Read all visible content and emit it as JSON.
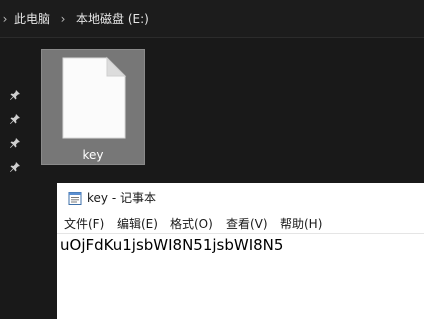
{
  "explorer": {
    "breadcrumb": [
      {
        "label": "此电脑"
      },
      {
        "label": "本地磁盘 (E:)"
      }
    ],
    "file": {
      "name": "key",
      "icon": "text-file-icon"
    },
    "nav_pins": [
      "pin-icon",
      "pin-icon",
      "pin-icon",
      "pin-icon"
    ]
  },
  "notepad": {
    "title": "key - 记事本",
    "menu": [
      "文件(F)",
      "编辑(E)",
      "格式(O)",
      "查看(V)",
      "帮助(H)"
    ],
    "content": "uOjFdKu1jsbWI8N51jsbWI8N5"
  },
  "colors": {
    "explorer_bg": "#191919",
    "selected_tile": "#777777",
    "notepad_bg": "#ffffff"
  }
}
